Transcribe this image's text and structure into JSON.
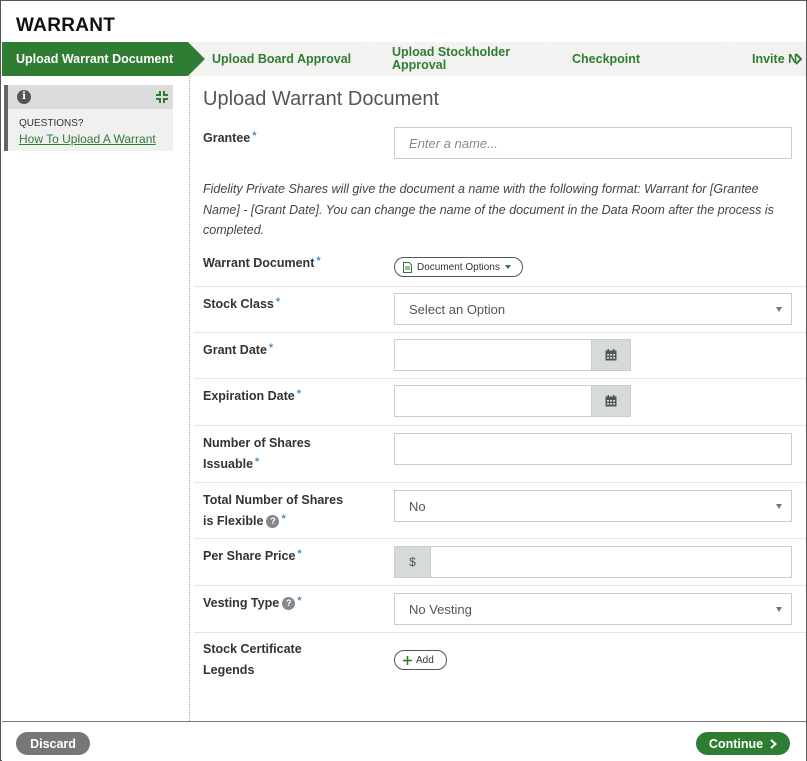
{
  "app": {
    "title": "WARRANT"
  },
  "stepper": {
    "steps": [
      {
        "label": "Upload Warrant Document",
        "active": true
      },
      {
        "label": "Upload Board Approval",
        "active": false
      },
      {
        "label": "Upload Stockholder Approval",
        "line1": "Upload Stockholder",
        "line2": "Approval",
        "active": false
      },
      {
        "label": "Checkpoint",
        "active": false
      },
      {
        "label": "Invite N",
        "active": false
      }
    ]
  },
  "help": {
    "icon": "info-icon",
    "collapse_icon": "collapse-icon",
    "questions": "QUESTIONS?",
    "link": "How To Upload A Warrant"
  },
  "form": {
    "title": "Upload Warrant Document",
    "required_marker": "*",
    "grantee": {
      "label": "Grantee",
      "placeholder": "Enter a name..."
    },
    "note": "Fidelity Private Shares will give the document a name with the following format: Warrant for [Grantee Name] - [Grant Date]. You can change the name of the document in the Data Room after the process is completed.",
    "warrant_document": {
      "label": "Warrant Document",
      "button": "Document Options"
    },
    "stock_class": {
      "label": "Stock Class",
      "value": "Select an Option"
    },
    "grant_date": {
      "label": "Grant Date",
      "value": ""
    },
    "expiration_date": {
      "label": "Expiration Date",
      "value": ""
    },
    "number_of_shares": {
      "label_line1": "Number of Shares",
      "label_line2": "Issuable",
      "value": ""
    },
    "shares_flexible": {
      "label_line1": "Total Number of Shares",
      "label_line2": "is Flexible",
      "value": "No"
    },
    "per_share_price": {
      "label": "Per Share Price",
      "currency": "$",
      "value": ""
    },
    "vesting_type": {
      "label": "Vesting Type",
      "value": "No Vesting"
    },
    "legends": {
      "label_line1": "Stock Certificate",
      "label_line2": "Legends",
      "button": "Add"
    }
  },
  "footer": {
    "discard": "Discard",
    "continue": "Continue"
  },
  "colors": {
    "accent": "#2e7d32",
    "required": "#4a8fc4",
    "discard": "#777777"
  }
}
